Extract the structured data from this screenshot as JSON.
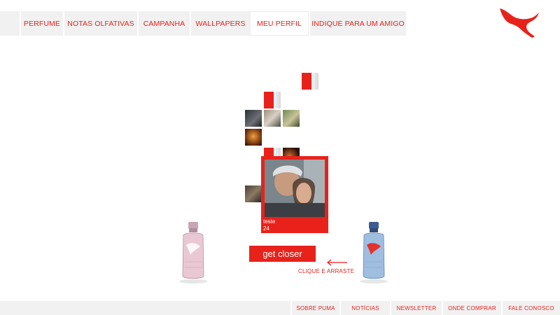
{
  "nav": {
    "tabs": [
      {
        "label": "PERFUME"
      },
      {
        "label": "NOTAS OLFATIVAS"
      },
      {
        "label": "CAMPANHA"
      },
      {
        "label": "WALLPAPERS"
      },
      {
        "label": "MEU PERFIL",
        "active": true
      },
      {
        "label": "INDIQUE PARA UM AMIGO"
      }
    ]
  },
  "brand": {
    "logo_icon": "puma-cat-logo",
    "accent": "#e8221b"
  },
  "selected_profile": {
    "name": "teste",
    "number": "24"
  },
  "cta": {
    "button_label": "get closer",
    "hint": "CLIQUE E ARRASTE"
  },
  "footer": {
    "links": [
      {
        "label": "SOBRE PUMA"
      },
      {
        "label": "NOTÍCIAS"
      },
      {
        "label": "NEWSLETTER"
      },
      {
        "label": "ONDE COMPRAR"
      },
      {
        "label": "FALE CONOSCO"
      }
    ]
  }
}
